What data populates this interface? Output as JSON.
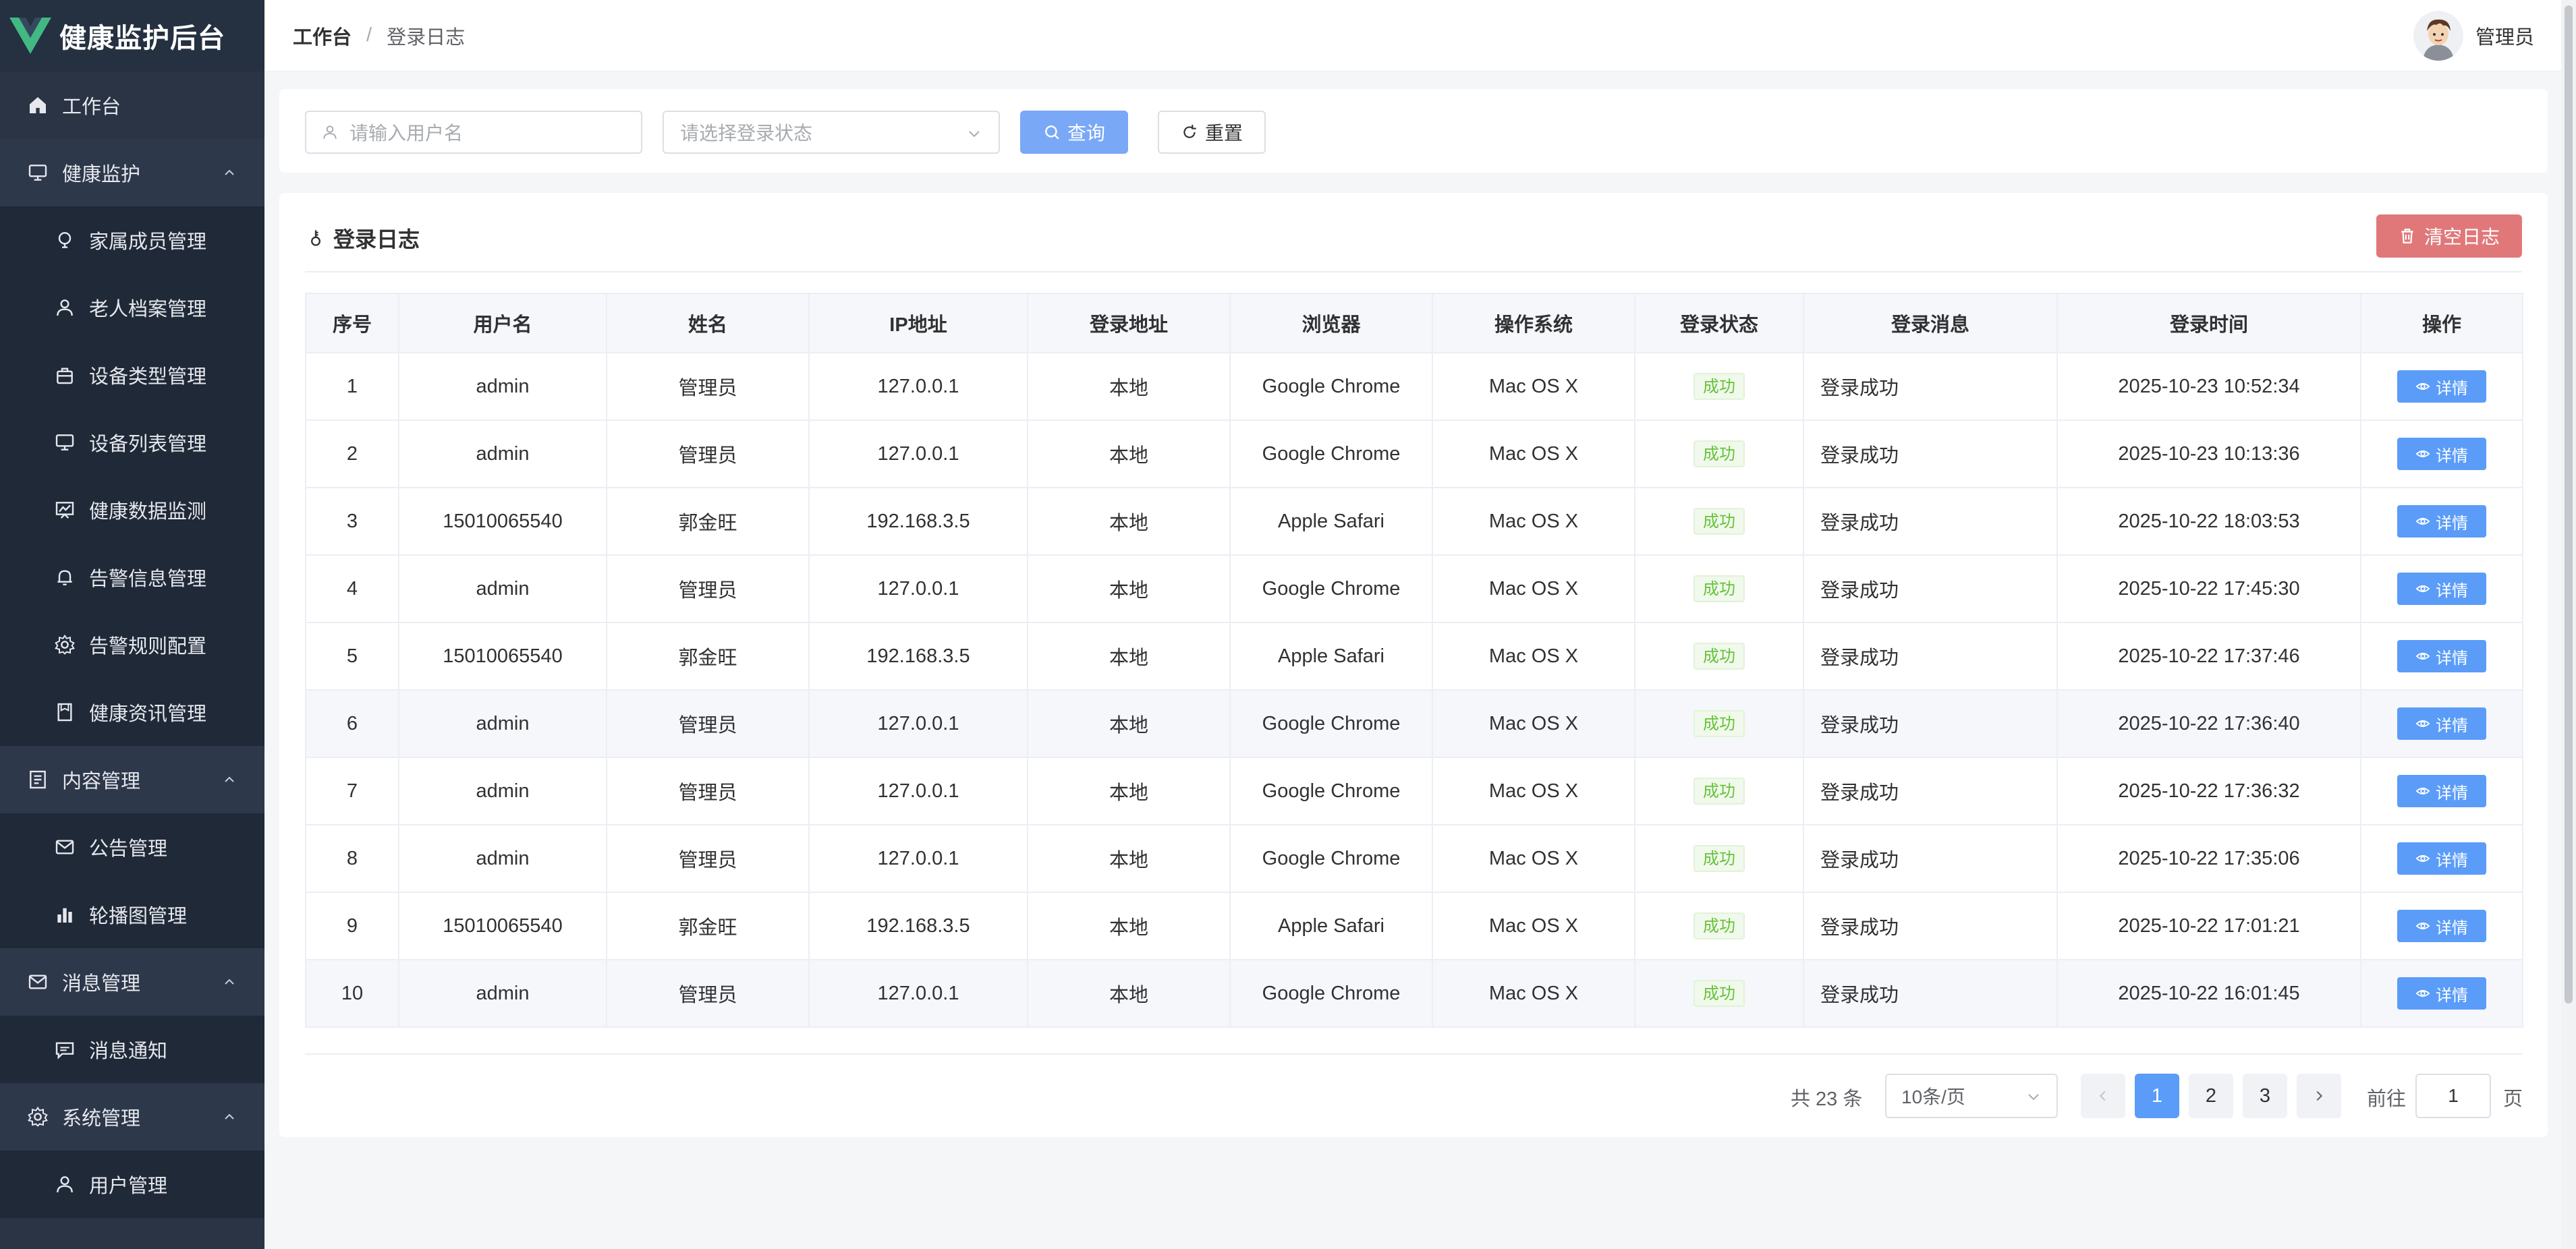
{
  "app": {
    "title": "健康监护后台"
  },
  "sidebar": {
    "items": [
      {
        "label": "工作台",
        "icon": "home-icon",
        "type": "top"
      },
      {
        "label": "健康监护",
        "icon": "monitor-icon",
        "type": "group"
      },
      {
        "label": "家属成员管理",
        "icon": "bulb-icon",
        "type": "sub"
      },
      {
        "label": "老人档案管理",
        "icon": "user-icon",
        "type": "sub"
      },
      {
        "label": "设备类型管理",
        "icon": "bag-icon",
        "type": "sub"
      },
      {
        "label": "设备列表管理",
        "icon": "monitor-icon",
        "type": "sub"
      },
      {
        "label": "健康数据监测",
        "icon": "board-icon",
        "type": "sub"
      },
      {
        "label": "告警信息管理",
        "icon": "bell-icon",
        "type": "sub"
      },
      {
        "label": "告警规则配置",
        "icon": "gear-icon",
        "type": "sub"
      },
      {
        "label": "健康资讯管理",
        "icon": "doc-icon",
        "type": "sub"
      },
      {
        "label": "内容管理",
        "icon": "list-icon",
        "type": "group"
      },
      {
        "label": "公告管理",
        "icon": "mail-icon",
        "type": "sub"
      },
      {
        "label": "轮播图管理",
        "icon": "chart-icon",
        "type": "sub"
      },
      {
        "label": "消息管理",
        "icon": "mail-icon",
        "type": "group"
      },
      {
        "label": "消息通知",
        "icon": "chat-icon",
        "type": "sub"
      },
      {
        "label": "系统管理",
        "icon": "gear-icon",
        "type": "group"
      },
      {
        "label": "用户管理",
        "icon": "user-icon",
        "type": "sub"
      }
    ]
  },
  "header": {
    "breadcrumb": [
      "工作台",
      "登录日志"
    ],
    "separator": "/",
    "user_name": "管理员"
  },
  "search": {
    "username_placeholder": "请输入用户名",
    "status_placeholder": "请选择登录状态",
    "query_label": "查询",
    "reset_label": "重置"
  },
  "card": {
    "title": "登录日志",
    "clear_label": "清空日志"
  },
  "table": {
    "columns": [
      "序号",
      "用户名",
      "姓名",
      "IP地址",
      "登录地址",
      "浏览器",
      "操作系统",
      "登录状态",
      "登录消息",
      "登录时间",
      "操作"
    ],
    "detail_label": "详情",
    "rows": [
      {
        "idx": "1",
        "username": "admin",
        "name": "管理员",
        "ip": "127.0.0.1",
        "location": "本地",
        "browser": "Google Chrome",
        "os": "Mac OS X",
        "status": "成功",
        "msg": "登录成功",
        "time": "2025-10-23 10:52:34"
      },
      {
        "idx": "2",
        "username": "admin",
        "name": "管理员",
        "ip": "127.0.0.1",
        "location": "本地",
        "browser": "Google Chrome",
        "os": "Mac OS X",
        "status": "成功",
        "msg": "登录成功",
        "time": "2025-10-23 10:13:36"
      },
      {
        "idx": "3",
        "username": "15010065540",
        "name": "郭金旺",
        "ip": "192.168.3.5",
        "location": "本地",
        "browser": "Apple Safari",
        "os": "Mac OS X",
        "status": "成功",
        "msg": "登录成功",
        "time": "2025-10-22 18:03:53"
      },
      {
        "idx": "4",
        "username": "admin",
        "name": "管理员",
        "ip": "127.0.0.1",
        "location": "本地",
        "browser": "Google Chrome",
        "os": "Mac OS X",
        "status": "成功",
        "msg": "登录成功",
        "time": "2025-10-22 17:45:30"
      },
      {
        "idx": "5",
        "username": "15010065540",
        "name": "郭金旺",
        "ip": "192.168.3.5",
        "location": "本地",
        "browser": "Apple Safari",
        "os": "Mac OS X",
        "status": "成功",
        "msg": "登录成功",
        "time": "2025-10-22 17:37:46"
      },
      {
        "idx": "6",
        "username": "admin",
        "name": "管理员",
        "ip": "127.0.0.1",
        "location": "本地",
        "browser": "Google Chrome",
        "os": "Mac OS X",
        "status": "成功",
        "msg": "登录成功",
        "time": "2025-10-22 17:36:40"
      },
      {
        "idx": "7",
        "username": "admin",
        "name": "管理员",
        "ip": "127.0.0.1",
        "location": "本地",
        "browser": "Google Chrome",
        "os": "Mac OS X",
        "status": "成功",
        "msg": "登录成功",
        "time": "2025-10-22 17:36:32"
      },
      {
        "idx": "8",
        "username": "admin",
        "name": "管理员",
        "ip": "127.0.0.1",
        "location": "本地",
        "browser": "Google Chrome",
        "os": "Mac OS X",
        "status": "成功",
        "msg": "登录成功",
        "time": "2025-10-22 17:35:06"
      },
      {
        "idx": "9",
        "username": "15010065540",
        "name": "郭金旺",
        "ip": "192.168.3.5",
        "location": "本地",
        "browser": "Apple Safari",
        "os": "Mac OS X",
        "status": "成功",
        "msg": "登录成功",
        "time": "2025-10-22 17:01:21"
      },
      {
        "idx": "10",
        "username": "admin",
        "name": "管理员",
        "ip": "127.0.0.1",
        "location": "本地",
        "browser": "Google Chrome",
        "os": "Mac OS X",
        "status": "成功",
        "msg": "登录成功",
        "time": "2025-10-22 16:01:45"
      }
    ]
  },
  "pagination": {
    "total_text": "共 23 条",
    "page_size": "10条/页",
    "pages": [
      "1",
      "2",
      "3"
    ],
    "current_page": "1",
    "goto_prefix": "前往",
    "goto_value": "1",
    "goto_suffix": "页"
  },
  "colors": {
    "sidebar_bg": "#2a3445",
    "primary": "#5a9cf8",
    "danger": "#e0787a",
    "success": "#67c23a"
  }
}
